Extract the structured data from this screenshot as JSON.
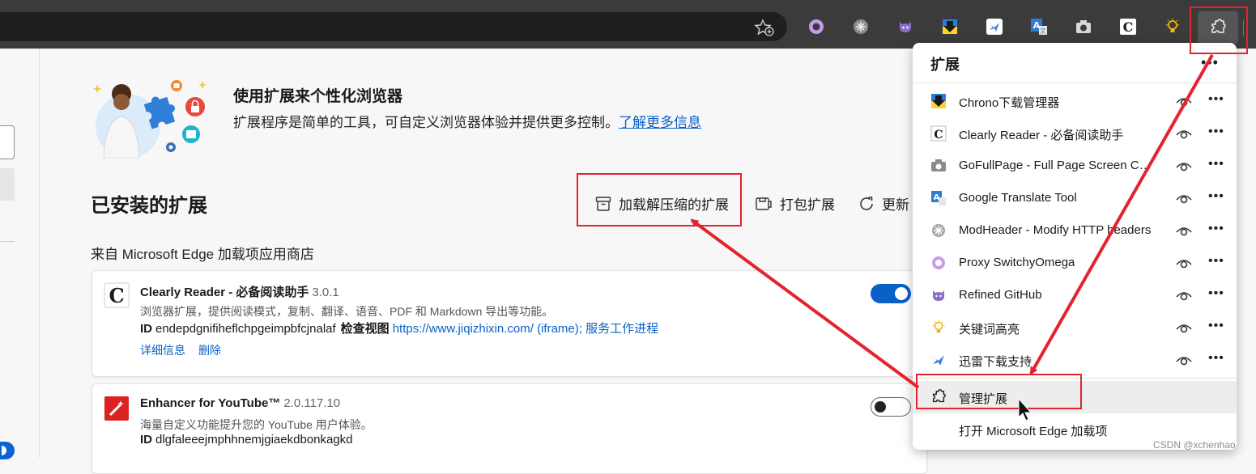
{
  "hero": {
    "title": "使用扩展来个性化浏览器",
    "description": "扩展程序是简单的工具，可自定义浏览器体验并提供更多控制。",
    "learn_more": "了解更多信息"
  },
  "installed": {
    "title": "已安装的扩展",
    "actions": {
      "load_unpacked": "加载解压缩的扩展",
      "pack": "打包扩展",
      "update": "更新"
    },
    "store_section": "来自 Microsoft Edge 加载项应用商店"
  },
  "cards": [
    {
      "name": "Clearly Reader - 必备阅读助手",
      "version": "3.0.1",
      "description": "浏览器扩展，提供阅读模式，复制、翻译、语音、PDF 和 Markdown 导出等功能。",
      "id_label": "ID",
      "id": "endepdgnifiheflchpgeimpbfcjnalaf",
      "inspect_label": "检查视图",
      "inspect_links": "https://www.jiqizhixin.com/ (iframe); 服务工作进程",
      "details": "详细信息",
      "remove": "删除",
      "enabled": true
    },
    {
      "name": "Enhancer for YouTube™",
      "version": "2.0.117.10",
      "description": "海量自定义功能提升您的 YouTube 用户体验。",
      "id_label": "ID",
      "id": "dlgfaleeejmphhnemjgiaekdbonkagkd",
      "enabled": false
    }
  ],
  "popup": {
    "title": "扩展",
    "more": "•••",
    "items": [
      {
        "label": "Chrono下载管理器",
        "icon": "chrono-download-icon"
      },
      {
        "label": "Clearly Reader - 必备阅读助手",
        "icon": "clearly-reader-icon"
      },
      {
        "label": "GoFullPage - Full Page Screen Capture",
        "icon": "camera-icon"
      },
      {
        "label": "Google Translate Tool",
        "icon": "translate-icon"
      },
      {
        "label": "ModHeader - Modify HTTP headers",
        "icon": "modheader-icon"
      },
      {
        "label": "Proxy SwitchyOmega",
        "icon": "switchyomega-icon"
      },
      {
        "label": "Refined GitHub",
        "icon": "github-cat-icon"
      },
      {
        "label": "关键词高亮",
        "icon": "lightbulb-icon"
      },
      {
        "label": "迅雷下载支持",
        "icon": "thunder-icon"
      }
    ],
    "item_more": "•••",
    "manage": "管理扩展",
    "open_store": "打开 Microsoft Edge 加载项"
  },
  "watermark": "CSDN @xchenhao",
  "colors": {
    "accent": "#0b60c7",
    "annotation": "#e3232e",
    "toolbar": "#3b3b3b"
  }
}
